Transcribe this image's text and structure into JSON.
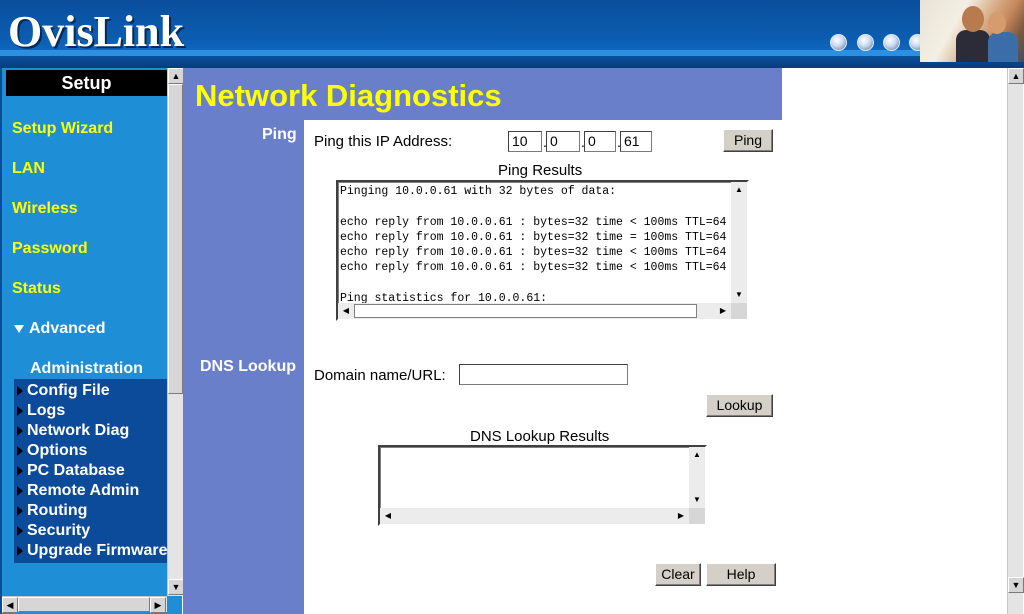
{
  "header": {
    "logo": "OvisLink",
    "icons": [
      "globe-icon",
      "globe-icon",
      "globe-icon",
      "globe-icon"
    ]
  },
  "sidebar": {
    "title": "Setup",
    "links": [
      "Setup Wizard",
      "LAN",
      "Wireless",
      "Password",
      "Status"
    ],
    "advanced": "Advanced",
    "admin_title": "Administration",
    "items": [
      "Config File",
      "Logs",
      "Network Diag",
      "Options",
      "PC Database",
      "Remote Admin",
      "Routing",
      "Security",
      "Upgrade Firmware"
    ]
  },
  "main": {
    "title": "Network Diagnostics",
    "ping": {
      "section_label": "Ping",
      "ip_label": "Ping this IP Address:",
      "ip": [
        "10",
        "0",
        "0",
        "61"
      ],
      "button": "Ping",
      "results_label": "Ping Results",
      "results": "Pinging 10.0.0.61 with 32 bytes of data:\n\necho reply from 10.0.0.61 : bytes=32 time < 100ms TTL=64\necho reply from 10.0.0.61 : bytes=32 time = 100ms TTL=64\necho reply from 10.0.0.61 : bytes=32 time < 100ms TTL=64\necho reply from 10.0.0.61 : bytes=32 time < 100ms TTL=64\n\nPing statistics for 10.0.0.61:"
    },
    "dns": {
      "section_label": "DNS Lookup",
      "domain_label": "Domain name/URL:",
      "domain_value": "",
      "button": "Lookup",
      "results_label": "DNS Lookup Results",
      "results": ""
    },
    "buttons": {
      "clear": "Clear",
      "help": "Help"
    }
  }
}
